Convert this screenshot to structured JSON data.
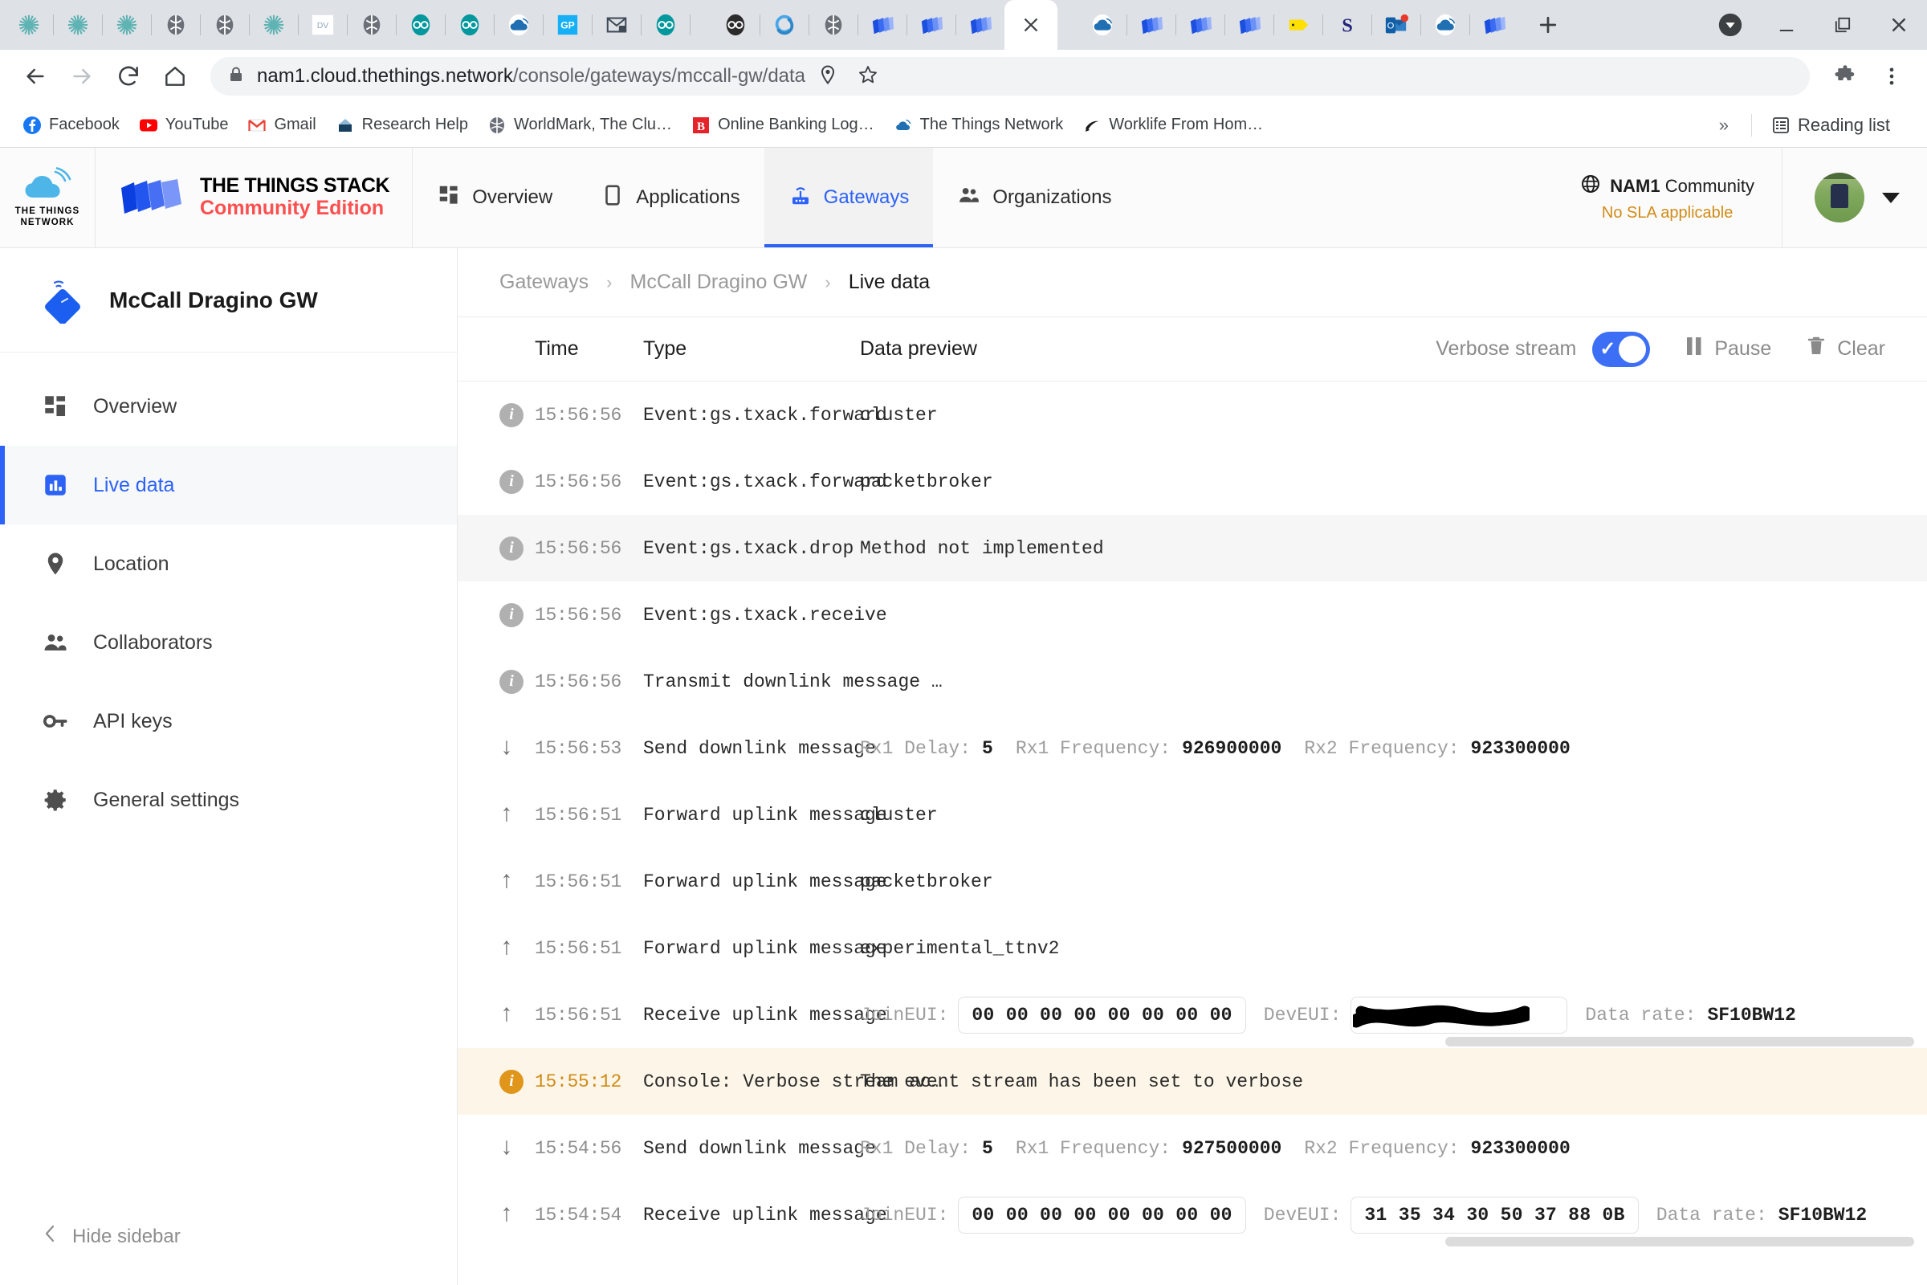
{
  "browser": {
    "tabs": [
      {
        "name": "tab-sunburst-1",
        "icon": "sunburst-icon",
        "active": false
      },
      {
        "name": "tab-sunburst-2",
        "icon": "sunburst-icon",
        "active": false
      },
      {
        "name": "tab-sunburst-3",
        "icon": "sunburst-icon",
        "active": false
      },
      {
        "name": "tab-globe-1",
        "icon": "globe-icon",
        "active": false
      },
      {
        "name": "tab-globe-2",
        "icon": "globe-icon",
        "active": false
      },
      {
        "name": "tab-sunburst-4",
        "icon": "sunburst-icon",
        "active": false
      },
      {
        "name": "tab-dv",
        "icon": "dv-icon",
        "active": false
      },
      {
        "name": "tab-globe-3",
        "icon": "globe-icon",
        "active": false
      },
      {
        "name": "tab-arduino-1",
        "icon": "arduino-icon",
        "active": false
      },
      {
        "name": "tab-arduino-2",
        "icon": "arduino-icon",
        "active": false
      },
      {
        "name": "tab-ttn-1",
        "icon": "ttn-cloud-icon",
        "active": false
      },
      {
        "name": "tab-gp",
        "icon": "gp-icon",
        "active": false
      },
      {
        "name": "tab-securemail",
        "icon": "secure-mail-icon",
        "active": false
      },
      {
        "name": "tab-arduino-3",
        "icon": "arduino-icon",
        "active": false
      },
      {
        "name": "tab-arduino-dark",
        "icon": "arduino-dark-icon",
        "active": false
      },
      {
        "name": "tab-sync",
        "icon": "sync-icon",
        "active": false
      },
      {
        "name": "tab-globe-4",
        "icon": "globe-icon",
        "active": false
      },
      {
        "name": "tab-stack-1",
        "icon": "things-stack-icon",
        "active": false
      },
      {
        "name": "tab-stack-2",
        "icon": "things-stack-icon",
        "active": false
      },
      {
        "name": "tab-stack-3",
        "icon": "things-stack-icon",
        "active": false
      },
      {
        "name": "tab-livedata",
        "icon": "close-icon",
        "active": true
      },
      {
        "name": "tab-ttn-2",
        "icon": "ttn-cloud-icon",
        "active": false
      },
      {
        "name": "tab-stack-4",
        "icon": "things-stack-icon",
        "active": false
      },
      {
        "name": "tab-stack-5",
        "icon": "things-stack-icon",
        "active": false
      },
      {
        "name": "tab-stack-6",
        "icon": "things-stack-icon",
        "active": false
      },
      {
        "name": "tab-tag",
        "icon": "yellow-tag-icon",
        "active": false
      },
      {
        "name": "tab-s",
        "icon": "letter-s-icon",
        "active": false
      },
      {
        "name": "tab-outlook",
        "icon": "outlook-icon",
        "active": false
      },
      {
        "name": "tab-ttn-3",
        "icon": "ttn-cloud-icon",
        "active": false
      },
      {
        "name": "tab-stack-7",
        "icon": "things-stack-icon",
        "active": false
      }
    ],
    "new_tab_label": "+",
    "window_controls": {
      "profile": "profile-icon",
      "minimize": "minimize-icon",
      "maximize": "maximize-icon",
      "close": "close-icon"
    },
    "nav": {
      "back": "back-arrow-icon",
      "forward": "forward-arrow-icon",
      "reload": "reload-icon",
      "home": "home-icon"
    },
    "omnibox": {
      "lock": "lock-icon",
      "url_bold": "nam1.cloud.thethings.network",
      "url_dim": "/console/gateways/mccall-gw/data",
      "location_icon": "location-pin-icon",
      "star_icon": "bookmark-star-icon",
      "extensions_icon": "puzzle-piece-icon",
      "menu_icon": "three-dot-menu-icon"
    },
    "bookmarks": [
      {
        "label": "Facebook",
        "icon": "facebook-icon"
      },
      {
        "label": "YouTube",
        "icon": "youtube-icon"
      },
      {
        "label": "Gmail",
        "icon": "gmail-icon"
      },
      {
        "label": "Research Help",
        "icon": "research-help-icon"
      },
      {
        "label": "WorldMark, The Clu…",
        "icon": "globe-icon"
      },
      {
        "label": "Online Banking Log…",
        "icon": "letter-b-icon"
      },
      {
        "label": "The Things Network",
        "icon": "ttn-cloud-icon"
      },
      {
        "label": "Worklife From Hom…",
        "icon": "worklife-icon"
      }
    ],
    "bookmarks_overflow": "»",
    "reading_list": {
      "label": "Reading list",
      "icon": "reading-list-icon"
    }
  },
  "appheader": {
    "logo_ttn_line1": "THE THINGS",
    "logo_ttn_line2": "NETWORK",
    "stack_line1": "THE THINGS STACK",
    "stack_line2": "Community Edition",
    "nav": [
      {
        "label": "Overview",
        "icon": "overview-grid-icon",
        "active": false
      },
      {
        "label": "Applications",
        "icon": "application-icon",
        "active": false
      },
      {
        "label": "Gateways",
        "icon": "gateway-router-icon",
        "active": true
      },
      {
        "label": "Organizations",
        "icon": "organizations-people-icon",
        "active": false
      }
    ],
    "cluster_name_bold": "NAM1",
    "cluster_name_rest": "Community",
    "cluster_icon": "globe-icon",
    "sla_text": "No SLA applicable",
    "avatar": "user-avatar",
    "avatar_caret": "chevron-down-icon"
  },
  "sidebar": {
    "title": "McCall Dragino GW",
    "title_icon": "gateway-diamond-icon",
    "items": [
      {
        "label": "Overview",
        "icon": "overview-grid-icon",
        "active": false
      },
      {
        "label": "Live data",
        "icon": "live-data-chart-icon",
        "active": true
      },
      {
        "label": "Location",
        "icon": "location-pin-icon",
        "active": false
      },
      {
        "label": "Collaborators",
        "icon": "collaborators-people-icon",
        "active": false
      },
      {
        "label": "API keys",
        "icon": "api-key-icon",
        "active": false
      },
      {
        "label": "General settings",
        "icon": "gear-icon",
        "active": false
      }
    ],
    "hide_label": "Hide sidebar",
    "hide_icon": "chevron-left-icon"
  },
  "breadcrumb": [
    {
      "label": "Gateways",
      "current": false
    },
    {
      "label": "McCall Dragino GW",
      "current": false
    },
    {
      "label": "Live data",
      "current": true
    }
  ],
  "breadcrumb_separator": "›",
  "table": {
    "columns": {
      "time": "Time",
      "type": "Type",
      "preview": "Data preview"
    },
    "controls": {
      "verbose_label": "Verbose stream",
      "verbose_on": true,
      "pause_label": "Pause",
      "pause_icon": "pause-icon",
      "clear_label": "Clear",
      "clear_icon": "trash-icon"
    },
    "rows": [
      {
        "icon": "info-icon",
        "dir": "none",
        "time": "15:56:56",
        "type": "Event:gs.txack.forward",
        "preview_kind": "text",
        "preview": "cluster",
        "style": "plain"
      },
      {
        "icon": "info-icon",
        "dir": "none",
        "time": "15:56:56",
        "type": "Event:gs.txack.forward",
        "preview_kind": "text",
        "preview": "packetbroker",
        "style": "plain"
      },
      {
        "icon": "info-icon",
        "dir": "none",
        "time": "15:56:56",
        "type": "Event:gs.txack.drop",
        "preview_kind": "text",
        "preview": "Method not implemented",
        "style": "alt"
      },
      {
        "icon": "info-icon",
        "dir": "none",
        "time": "15:56:56",
        "type": "Event:gs.txack.receive",
        "preview_kind": "text",
        "preview": "",
        "style": "plain"
      },
      {
        "icon": "info-icon",
        "dir": "none",
        "time": "15:56:56",
        "type": "Transmit downlink message …",
        "preview_kind": "text",
        "preview": "",
        "style": "plain"
      },
      {
        "icon": "arrow-down-icon",
        "dir": "down",
        "time": "15:56:53",
        "type": "Send downlink message",
        "preview_kind": "kv",
        "kv": [
          {
            "k": "Rx1 Delay:",
            "v": "5"
          },
          {
            "k": "Rx1 Frequency:",
            "v": "926900000"
          },
          {
            "k": "Rx2 Frequency:",
            "v": "923300000"
          }
        ],
        "style": "plain"
      },
      {
        "icon": "arrow-up-icon",
        "dir": "up",
        "time": "15:56:51",
        "type": "Forward uplink message",
        "preview_kind": "text",
        "preview": "cluster",
        "style": "plain"
      },
      {
        "icon": "arrow-up-icon",
        "dir": "up",
        "time": "15:56:51",
        "type": "Forward uplink message",
        "preview_kind": "text",
        "preview": "packetbroker",
        "style": "plain"
      },
      {
        "icon": "arrow-up-icon",
        "dir": "up",
        "time": "15:56:51",
        "type": "Forward uplink message",
        "preview_kind": "text",
        "preview": "experimental_ttnv2",
        "style": "plain"
      },
      {
        "icon": "arrow-up-icon",
        "dir": "up",
        "time": "15:56:51",
        "type": "Receive uplink message",
        "preview_kind": "eui",
        "joineui_label": "JoinEUI:",
        "joineui": "00 00 00 00 00 00 00 00",
        "deveui_label": "DevEUI:",
        "deveui": "",
        "deveui_redacted": true,
        "datarate_label": "Data rate:",
        "datarate": "SF10BW12",
        "style": "plain"
      },
      {
        "icon": "info-icon-warn",
        "dir": "none",
        "time": "15:55:12",
        "type": "Console: Verbose stream ac…",
        "preview_kind": "text",
        "preview": "The event stream has been set to verbose",
        "style": "warn"
      },
      {
        "icon": "arrow-down-icon",
        "dir": "down",
        "time": "15:54:56",
        "type": "Send downlink message",
        "preview_kind": "kv",
        "kv": [
          {
            "k": "Rx1 Delay:",
            "v": "5"
          },
          {
            "k": "Rx1 Frequency:",
            "v": "927500000"
          },
          {
            "k": "Rx2 Frequency:",
            "v": "923300000"
          }
        ],
        "style": "plain"
      },
      {
        "icon": "arrow-up-icon",
        "dir": "up",
        "time": "15:54:54",
        "type": "Receive uplink message",
        "preview_kind": "eui",
        "joineui_label": "JoinEUI:",
        "joineui": "00 00 00 00 00 00 00 00",
        "deveui_label": "DevEUI:",
        "deveui": "31 35 34 30 50 37 88 0B",
        "deveui_redacted": false,
        "datarate_label": "Data rate:",
        "datarate": "SF10BW12",
        "style": "plain"
      }
    ]
  },
  "colors": {
    "accent_blue": "#2c62f6",
    "warn_amber": "#d18b16",
    "stack_red": "#fc4f4f",
    "chrome_tabstrip": "#dee1e6"
  }
}
